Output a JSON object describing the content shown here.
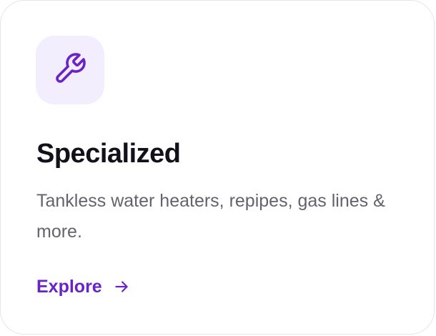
{
  "card": {
    "icon": "wrench-icon",
    "title": "Specialized",
    "description": "Tankless water heaters, repipes, gas lines & more.",
    "link_label": "Explore",
    "link_icon": "arrow-right-icon"
  },
  "colors": {
    "accent": "#6a23c9",
    "icon_tile_bg": "#f3eefe",
    "title": "#12111a",
    "body_text": "#63636e",
    "border": "#e5e5ea"
  }
}
